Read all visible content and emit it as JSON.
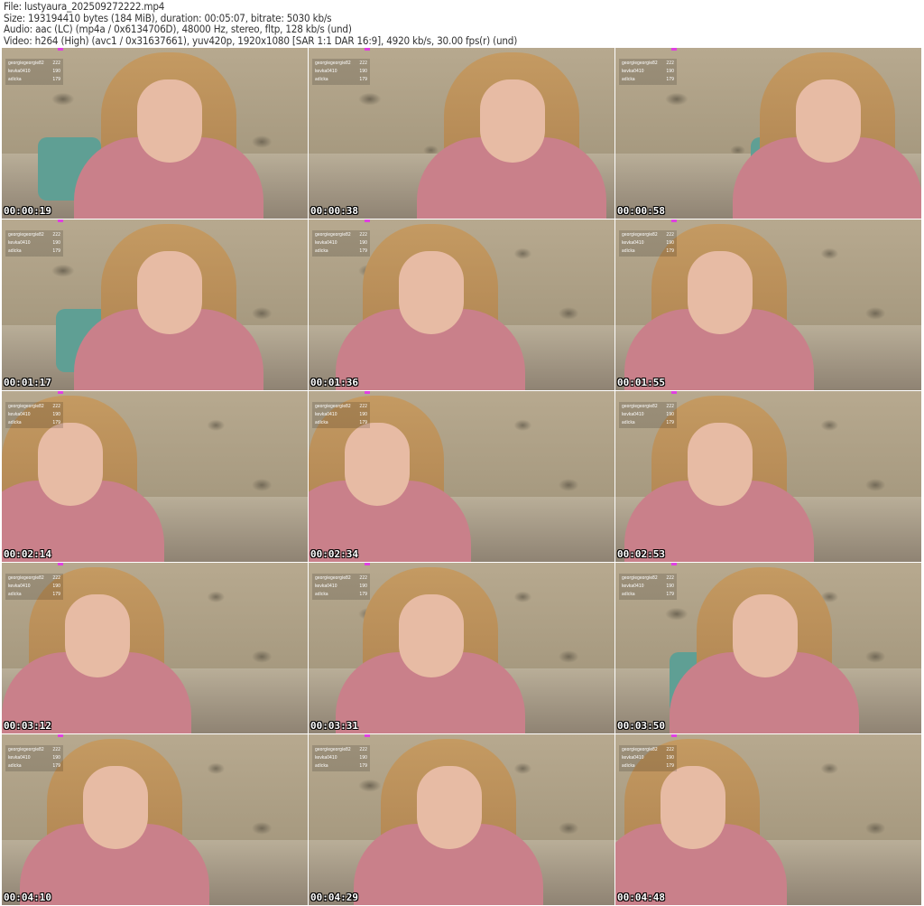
{
  "header": {
    "file": "File: lustyaura_202509272222.mp4",
    "size": "Size: 193194410 bytes (184 MiB), duration: 00:05:07, bitrate: 5030 kb/s",
    "audio": "Audio: aac (LC) (mp4a / 0x6134706D), 48000 Hz, stereo, fltp, 128 kb/s (und)",
    "video": "Video: h264 (High) (avc1 / 0x31637661), yuv420p, 1920x1080 [SAR 1:1 DAR 16:9], 4920 kb/s, 30.00 fps(r) (und)"
  },
  "leaderboard": [
    {
      "name": "georgiegeorgie82",
      "score": "222"
    },
    {
      "name": "kevka0410",
      "score": "190"
    },
    {
      "name": "adicka",
      "score": "179"
    }
  ],
  "thumbnails": [
    {
      "time": "00:00:19"
    },
    {
      "time": "00:00:38"
    },
    {
      "time": "00:00:58"
    },
    {
      "time": "00:01:17"
    },
    {
      "time": "00:01:36"
    },
    {
      "time": "00:01:55"
    },
    {
      "time": "00:02:14"
    },
    {
      "time": "00:02:34"
    },
    {
      "time": "00:02:53"
    },
    {
      "time": "00:03:12"
    },
    {
      "time": "00:03:31"
    },
    {
      "time": "00:03:50"
    },
    {
      "time": "00:04:10"
    },
    {
      "time": "00:04:29"
    },
    {
      "time": "00:04:48"
    }
  ]
}
